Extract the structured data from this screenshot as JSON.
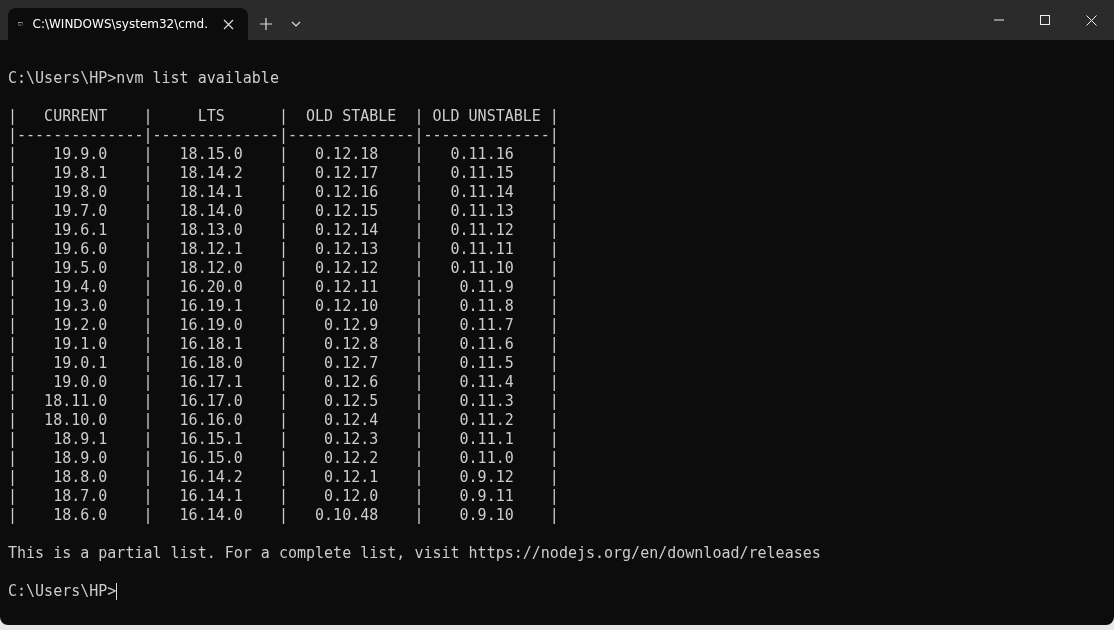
{
  "tab": {
    "title": "C:\\WINDOWS\\system32\\cmd.",
    "selected": true
  },
  "command_line": "C:\\Users\\HP>nvm list available",
  "table_lines": [
    "|   CURRENT    |     LTS      |  OLD STABLE  | OLD UNSTABLE |",
    "|--------------|--------------|--------------|--------------|",
    "|    19.9.0    |   18.15.0    |   0.12.18    |   0.11.16    |",
    "|    19.8.1    |   18.14.2    |   0.12.17    |   0.11.15    |",
    "|    19.8.0    |   18.14.1    |   0.12.16    |   0.11.14    |",
    "|    19.7.0    |   18.14.0    |   0.12.15    |   0.11.13    |",
    "|    19.6.1    |   18.13.0    |   0.12.14    |   0.11.12    |",
    "|    19.6.0    |   18.12.1    |   0.12.13    |   0.11.11    |",
    "|    19.5.0    |   18.12.0    |   0.12.12    |   0.11.10    |",
    "|    19.4.0    |   16.20.0    |   0.12.11    |    0.11.9    |",
    "|    19.3.0    |   16.19.1    |   0.12.10    |    0.11.8    |",
    "|    19.2.0    |   16.19.0    |    0.12.9    |    0.11.7    |",
    "|    19.1.0    |   16.18.1    |    0.12.8    |    0.11.6    |",
    "|    19.0.1    |   16.18.0    |    0.12.7    |    0.11.5    |",
    "|    19.0.0    |   16.17.1    |    0.12.6    |    0.11.4    |",
    "|   18.11.0    |   16.17.0    |    0.12.5    |    0.11.3    |",
    "|   18.10.0    |   16.16.0    |    0.12.4    |    0.11.2    |",
    "|    18.9.1    |   16.15.1    |    0.12.3    |    0.11.1    |",
    "|    18.9.0    |   16.15.0    |    0.12.2    |    0.11.0    |",
    "|    18.8.0    |   16.14.2    |    0.12.1    |    0.9.12    |",
    "|    18.7.0    |   16.14.1    |    0.12.0    |    0.9.11    |",
    "|    18.6.0    |   16.14.0    |   0.10.48    |    0.9.10    |"
  ],
  "note": "This is a partial list. For a complete list, visit https://nodejs.org/en/download/releases",
  "prompt": "C:\\Users\\HP>"
}
